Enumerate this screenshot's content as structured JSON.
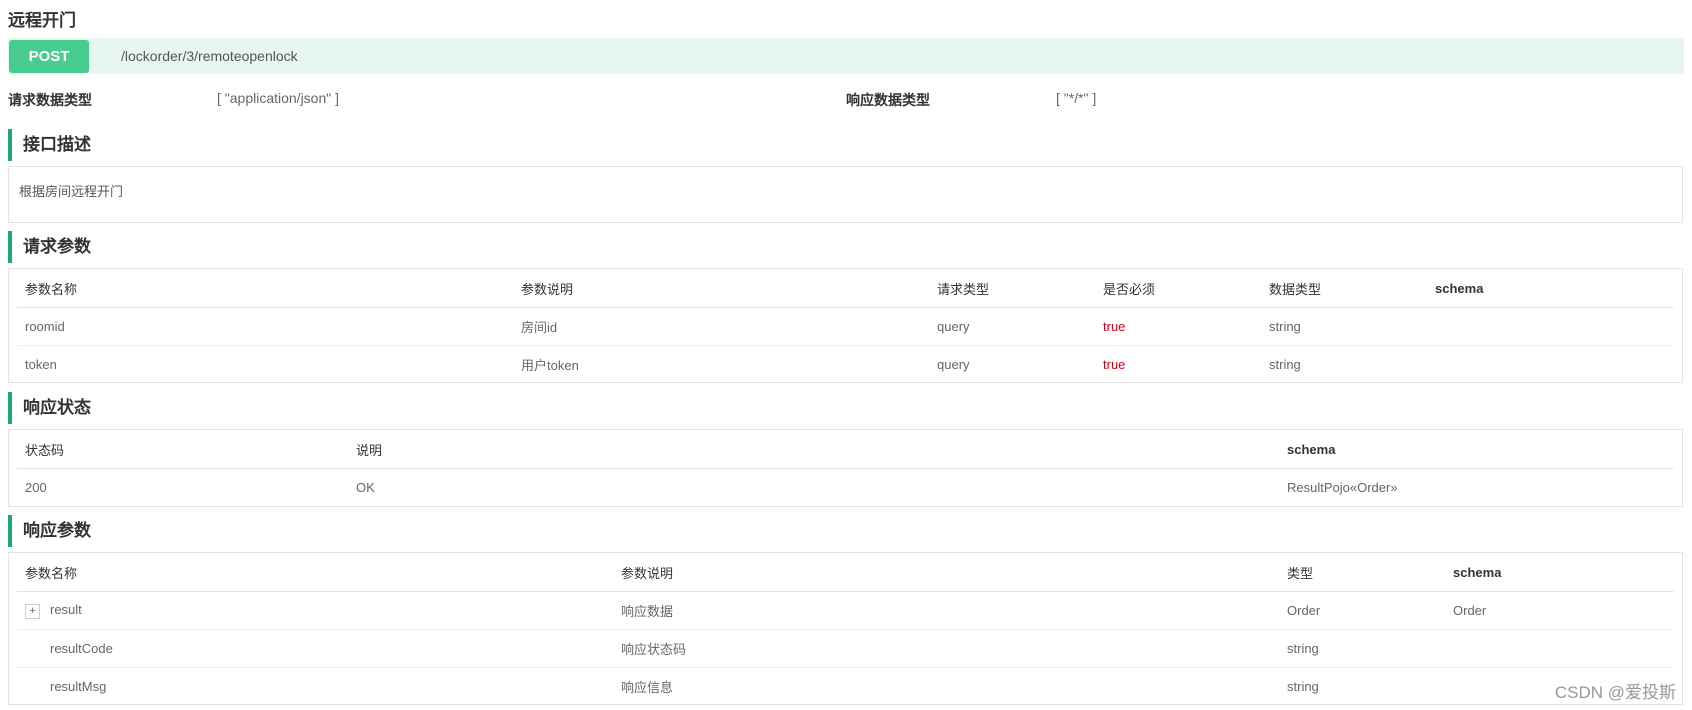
{
  "title": "远程开门",
  "method": "POST",
  "path": "/lockorder/3/remoteopenlock",
  "request_content_type_label": "请求数据类型",
  "request_content_type": "[ \"application/json\" ]",
  "response_content_type_label": "响应数据类型",
  "response_content_type": "[ \"*/*\" ]",
  "sections": {
    "description": {
      "title": "接口描述",
      "text": "根据房间远程开门"
    },
    "request_params": {
      "title": "请求参数",
      "columns": [
        "参数名称",
        "参数说明",
        "请求类型",
        "是否必须",
        "数据类型",
        "schema"
      ],
      "rows": [
        {
          "name": "roomid",
          "desc": "房间id",
          "in": "query",
          "required": "true",
          "type": "string",
          "schema": ""
        },
        {
          "name": "token",
          "desc": "用户token",
          "in": "query",
          "required": "true",
          "type": "string",
          "schema": ""
        }
      ]
    },
    "response_status": {
      "title": "响应状态",
      "columns": [
        "状态码",
        "说明",
        "schema"
      ],
      "rows": [
        {
          "code": "200",
          "desc": "OK",
          "schema": "ResultPojo«Order»"
        }
      ]
    },
    "response_params": {
      "title": "响应参数",
      "columns": [
        "参数名称",
        "参数说明",
        "类型",
        "schema"
      ],
      "rows": [
        {
          "name": "result",
          "desc": "响应数据",
          "type": "Order",
          "schema": "Order",
          "expandable": true
        },
        {
          "name": "resultCode",
          "desc": "响应状态码",
          "type": "string",
          "schema": ""
        },
        {
          "name": "resultMsg",
          "desc": "响应信息",
          "type": "string",
          "schema": ""
        }
      ]
    }
  },
  "watermark": "CSDN @爱投斯",
  "colors": {
    "post": "#49cc90",
    "url_bg": "#e7f6ee",
    "accent": "#1fa67a",
    "required": "#d0021b"
  }
}
